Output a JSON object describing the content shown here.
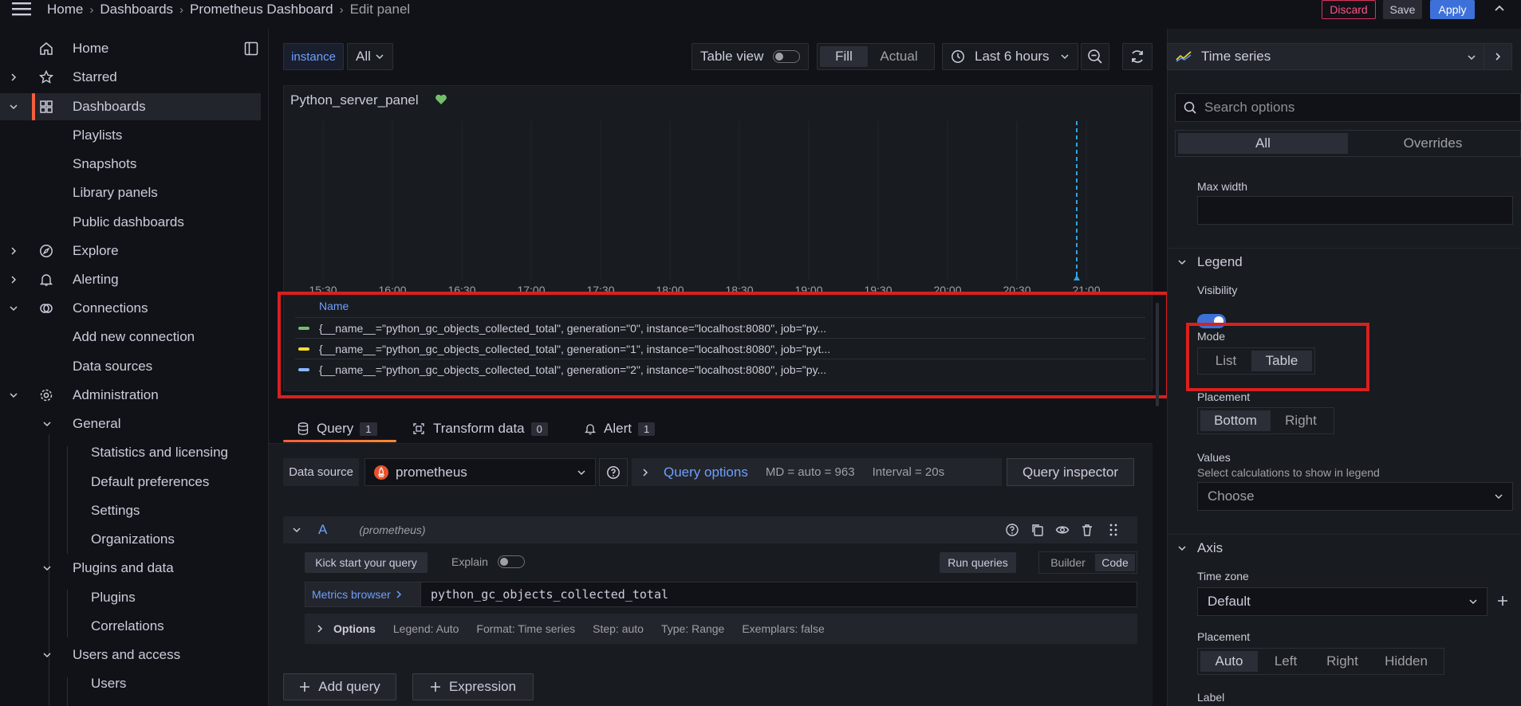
{
  "breadcrumb": {
    "items": [
      "Home",
      "Dashboards",
      "Prometheus Dashboard"
    ],
    "current": "Edit panel"
  },
  "header": {
    "discard": "Discard",
    "save": "Save",
    "apply": "Apply"
  },
  "sidebar": {
    "items": [
      {
        "label": "Home"
      },
      {
        "label": "Starred"
      },
      {
        "label": "Dashboards"
      },
      {
        "label": "Playlists"
      },
      {
        "label": "Snapshots"
      },
      {
        "label": "Library panels"
      },
      {
        "label": "Public dashboards"
      },
      {
        "label": "Explore"
      },
      {
        "label": "Alerting"
      },
      {
        "label": "Connections"
      },
      {
        "label": "Add new connection"
      },
      {
        "label": "Data sources"
      },
      {
        "label": "Administration"
      },
      {
        "label": "General"
      },
      {
        "label": "Statistics and licensing"
      },
      {
        "label": "Default preferences"
      },
      {
        "label": "Settings"
      },
      {
        "label": "Organizations"
      },
      {
        "label": "Plugins and data"
      },
      {
        "label": "Plugins"
      },
      {
        "label": "Correlations"
      },
      {
        "label": "Users and access"
      },
      {
        "label": "Users"
      }
    ]
  },
  "toolbar": {
    "variable_label": "instance",
    "variable_value": "All",
    "table_view": "Table view",
    "fill": "Fill",
    "actual": "Actual",
    "time_range": "Last 6 hours"
  },
  "panel": {
    "title": "Python_server_panel",
    "x_ticks": [
      "15:30",
      "16:00",
      "16:30",
      "17:00",
      "17:30",
      "18:00",
      "18:30",
      "19:00",
      "19:30",
      "20:00",
      "20:30",
      "21:00"
    ],
    "legend_header": "Name",
    "legend_rows": [
      {
        "text": "{__name__=\"python_gc_objects_collected_total\", generation=\"0\", instance=\"localhost:8080\", job=\"py...",
        "color": "#73bf69"
      },
      {
        "text": "{__name__=\"python_gc_objects_collected_total\", generation=\"1\", instance=\"localhost:8080\", job=\"pyt...",
        "color": "#fade2a"
      },
      {
        "text": "{__name__=\"python_gc_objects_collected_total\", generation=\"2\", instance=\"localhost:8080\", job=\"py...",
        "color": "#8ab8ff"
      }
    ]
  },
  "tabs": {
    "query": {
      "label": "Query",
      "count": "1"
    },
    "transform": {
      "label": "Transform data",
      "count": "0"
    },
    "alert": {
      "label": "Alert",
      "count": "1"
    }
  },
  "query": {
    "datasource_label": "Data source",
    "datasource": "prometheus",
    "options_link": "Query options",
    "md": "MD = auto = 963",
    "interval": "Interval = 20s",
    "inspector": "Query inspector",
    "ref_id": "A",
    "ref_ds": "(prometheus)",
    "kick_start": "Kick start your query",
    "explain": "Explain",
    "run": "Run queries",
    "builder": "Builder",
    "code": "Code",
    "metrics_browser": "Metrics browser",
    "expr": "python_gc_objects_collected_total",
    "options_title": "Options",
    "opt_legend": "Legend: Auto",
    "opt_format": "Format: Time series",
    "opt_step": "Step: auto",
    "opt_type": "Type: Range",
    "opt_exemplars": "Exemplars: false",
    "add_query": "Add query",
    "expression": "Expression"
  },
  "options": {
    "viz": "Time series",
    "search_placeholder": "Search options",
    "all": "All",
    "overrides": "Overrides",
    "max_width": "Max width",
    "legend_section": "Legend",
    "visibility": "Visibility",
    "mode": "Mode",
    "mode_list": "List",
    "mode_table": "Table",
    "placement": "Placement",
    "placement_bottom": "Bottom",
    "placement_right": "Right",
    "values": "Values",
    "values_desc": "Select calculations to show in legend",
    "values_placeholder": "Choose",
    "axis_section": "Axis",
    "timezone": "Time zone",
    "timezone_value": "Default",
    "axis_placement": "Placement",
    "ap_auto": "Auto",
    "ap_left": "Left",
    "ap_right": "Right",
    "ap_hidden": "Hidden",
    "label": "Label"
  },
  "colors": {
    "accent": "#3d71d9",
    "highlight_box": "#d9201f",
    "active_tab": "#f55f3e",
    "time_marker": "#33a2e5"
  }
}
